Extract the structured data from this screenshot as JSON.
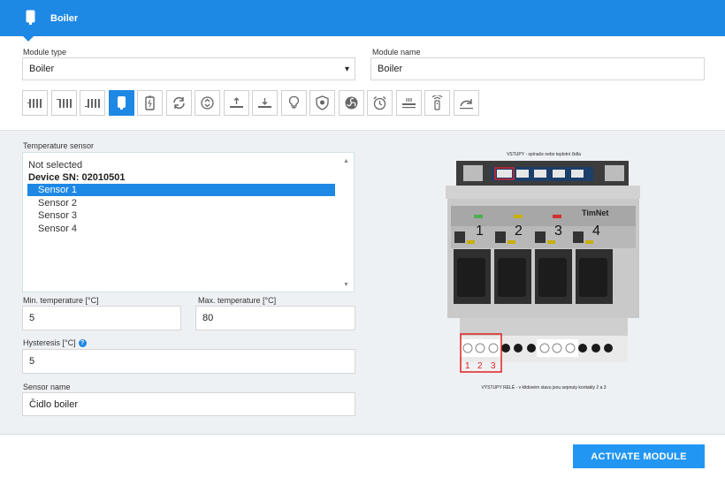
{
  "header": {
    "title": "Boiler",
    "icon": "boiler-icon",
    "color": "#1e88e5"
  },
  "module_type": {
    "label": "Module type",
    "value": "Boiler"
  },
  "module_name": {
    "label": "Module name",
    "value": "Boiler"
  },
  "module_icons": [
    {
      "name": "radiator-icon-1",
      "active": false
    },
    {
      "name": "radiator-icon-2",
      "active": false
    },
    {
      "name": "radiator-icon-3",
      "active": false
    },
    {
      "name": "boiler-icon",
      "active": true
    },
    {
      "name": "battery-icon",
      "active": false
    },
    {
      "name": "recirculation-icon",
      "active": false
    },
    {
      "name": "valve-icon",
      "active": false
    },
    {
      "name": "floor-heating-up-icon",
      "active": false
    },
    {
      "name": "floor-heating-down-icon",
      "active": false
    },
    {
      "name": "light-bulb-icon",
      "active": false
    },
    {
      "name": "shield-icon",
      "active": false
    },
    {
      "name": "fan-icon",
      "active": false
    },
    {
      "name": "alarm-clock-icon",
      "active": false
    },
    {
      "name": "heater-icon",
      "active": false
    },
    {
      "name": "remote-icon",
      "active": false
    },
    {
      "name": "redo-arrow-icon",
      "active": false
    }
  ],
  "temperature_sensor": {
    "label": "Temperature sensor",
    "items": [
      {
        "text": "Not selected",
        "type": "option"
      },
      {
        "text": "Device SN: 02010501",
        "type": "group"
      },
      {
        "text": "Sensor 1",
        "type": "option",
        "selected": true
      },
      {
        "text": "Sensor 2",
        "type": "option"
      },
      {
        "text": "Sensor 3",
        "type": "option"
      },
      {
        "text": "Sensor 4",
        "type": "option"
      }
    ]
  },
  "min_temp": {
    "label": "Min. temperature [°C]",
    "value": "5"
  },
  "max_temp": {
    "label": "Max. temperature [°C]",
    "value": "80"
  },
  "hysteresis": {
    "label": "Hysteresis [°C]",
    "value": "5",
    "help_icon": "help-icon"
  },
  "sensor_name": {
    "label": "Sensor name",
    "value": "Čidlo boiler"
  },
  "device_image": {
    "caption_top": "VSTUPY - spínače nebo teplotní čidla",
    "caption_bottom": "VÝSTUPY RELÉ - v klidovém stavu jsou sepnuty kontakty 2 a 3",
    "brand": "TimNet",
    "channels": [
      "1",
      "2",
      "3",
      "4"
    ],
    "terminals": [
      "1",
      "2",
      "3"
    ]
  },
  "activate_button": {
    "label": "ACTIVATE MODULE",
    "color": "#2196f3"
  }
}
